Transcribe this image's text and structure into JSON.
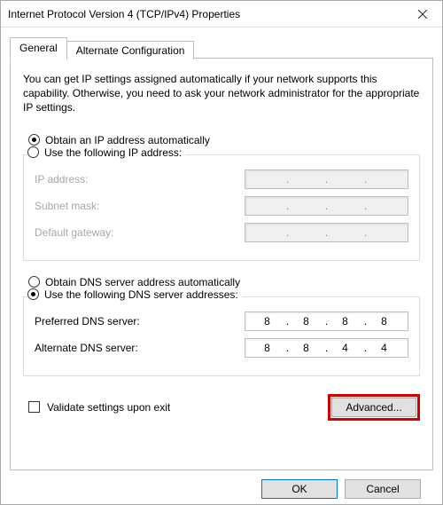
{
  "window": {
    "title": "Internet Protocol Version 4 (TCP/IPv4) Properties"
  },
  "tabs": {
    "general": "General",
    "alternate": "Alternate Configuration"
  },
  "intro": "You can get IP settings assigned automatically if your network supports this capability. Otherwise, you need to ask your network administrator for the appropriate IP settings.",
  "ip": {
    "auto_label": "Obtain an IP address automatically",
    "manual_label": "Use the following IP address:",
    "address_label": "IP address:",
    "subnet_label": "Subnet mask:",
    "gateway_label": "Default gateway:",
    "address_value": [
      "",
      "",
      "",
      ""
    ],
    "subnet_value": [
      "",
      "",
      "",
      ""
    ],
    "gateway_value": [
      "",
      "",
      "",
      ""
    ]
  },
  "dns": {
    "auto_label": "Obtain DNS server address automatically",
    "manual_label": "Use the following DNS server addresses:",
    "preferred_label": "Preferred DNS server:",
    "alternate_label": "Alternate DNS server:",
    "preferred_value": [
      "8",
      "8",
      "8",
      "8"
    ],
    "alternate_value": [
      "8",
      "8",
      "4",
      "4"
    ]
  },
  "validate_label": "Validate settings upon exit",
  "buttons": {
    "advanced": "Advanced...",
    "ok": "OK",
    "cancel": "Cancel"
  }
}
